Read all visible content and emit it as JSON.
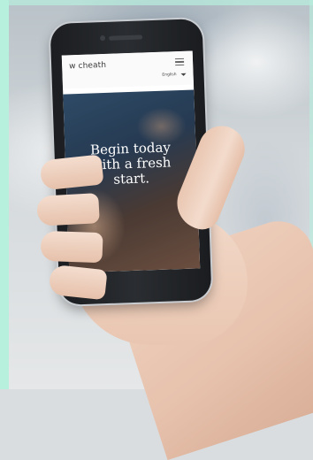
{
  "app": {
    "logo_text": "w cheath",
    "language": "English",
    "hero_line1": "Begin today",
    "hero_line2": "with a fresh",
    "hero_line3": "start."
  },
  "icons": {
    "menu": "hamburger-icon",
    "language_dropdown": "chevron-down-icon"
  },
  "colors": {
    "mint_accent": "#b8f0de",
    "phone_body": "#1f2226",
    "hero_text": "#ffffff"
  }
}
